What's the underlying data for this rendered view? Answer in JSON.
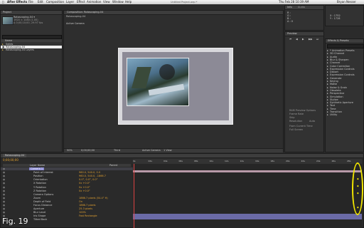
{
  "menubar": {
    "apple": "",
    "app_name": "After Effects",
    "items": [
      "File",
      "Edit",
      "Composition",
      "Layer",
      "Effect",
      "Animation",
      "View",
      "Window",
      "Help"
    ],
    "window_title": "Untitled Project.aep *",
    "clock": "Thu Feb 28  10:39 AM",
    "user": "Bryan Nesser"
  },
  "project_panel": {
    "tab": "Project",
    "item_name": "Rotoscoping-04 ▾",
    "item_info_1": "1920 × 1080 (1.00)",
    "item_info_2": "Δ 0;00;10;00, 29.97 fps",
    "search_placeholder": "",
    "column_header": "Name",
    "items": [
      "Solids",
      "Rotoscoping-04",
      "Rotoscoping-04 Layers"
    ]
  },
  "comp_viewer": {
    "tab": "Composition: Rotoscoping-04",
    "breadcrumb": "Rotoscoping-04",
    "camera_label": "Active Camera",
    "zoom": "50%",
    "timecode": "0;00;00;00",
    "resolution": "Third",
    "view": "Active Camera",
    "views": "1 View"
  },
  "info_panel": {
    "tab": "Info",
    "audio_tab": "Audio",
    "rgba": [
      "R :",
      "G :",
      "B :",
      "A : 0"
    ],
    "xy": [
      "X : 1752",
      "Y : 1728"
    ]
  },
  "preview_panel": {
    "tab": "Preview",
    "labels": [
      "RAM Preview Options",
      "Frame Rate",
      "Skip",
      "Resolution",
      "Auto",
      "From Current Time",
      "Full Screen"
    ]
  },
  "effects_panel": {
    "tab": "Effects & Presets",
    "search_placeholder": "",
    "categories": [
      "* Animation Presets",
      "3D Channel",
      "Audio",
      "Blur & Sharpen",
      "Channel",
      "Color Correction",
      "Expression Controls",
      "Distort",
      "Expression Controls",
      "Generate",
      "Keying",
      "Matte",
      "Noise & Grain",
      "Obsolete",
      "Perspective",
      "Simulation",
      "Stylize",
      "Synthetic Aperture",
      "Text",
      "Time",
      "Transition",
      "Utility"
    ]
  },
  "paragraph_panel": {
    "tab": "Paragraph"
  },
  "timeline": {
    "tab": "Rotoscoping-04",
    "timecode": "0;00;00;00",
    "search_placeholder": "",
    "layer_name_header": "Layer Name",
    "parent_header": "Parent",
    "layers": [
      {
        "name": "Camera 1",
        "value": "",
        "orange": false
      },
      {
        "name": "Point of Interest",
        "value": "960.0, 540.0, 0.0",
        "orange": true
      },
      {
        "name": "Position",
        "value": "960.0, 540.0, -1866.7",
        "orange": true
      },
      {
        "name": "Orientation",
        "value": "0.0°, 0.0°, 0.0°",
        "orange": true
      },
      {
        "name": "X Rotation",
        "value": "0x +0.0°",
        "orange": true
      },
      {
        "name": "Y Rotation",
        "value": "0x +0.0°",
        "orange": true
      },
      {
        "name": "Z Rotation",
        "value": "0x +0.0°",
        "orange": true
      },
      {
        "name": "Camera Options",
        "value": "",
        "orange": false
      },
      {
        "name": "Zoom",
        "value": "1866.7 pixels (54.4° H)",
        "orange": true
      },
      {
        "name": "Depth of Field",
        "value": "On",
        "orange": true
      },
      {
        "name": "Focus Distance",
        "value": "1866.7 pixels",
        "orange": true
      },
      {
        "name": "Aperture",
        "value": "25.3 pixels",
        "orange": true
      },
      {
        "name": "Blur Level",
        "value": "100%",
        "orange": true
      },
      {
        "name": "Iris Shape",
        "value": "Fast Rectangle",
        "orange": true
      },
      {
        "name": "Tilted Back",
        "value": "",
        "orange": false
      }
    ],
    "ruler": [
      "0s",
      "02s",
      "04s",
      "06s",
      "08s",
      "10s",
      "12s",
      "14s",
      "16s",
      "18s",
      "20s",
      "22s",
      "24s",
      "26s",
      "28s"
    ],
    "toggle_label": "Toggle Switches / Modes"
  },
  "fig_label": "Fig. 19",
  "colors": {
    "accent_orange": "#e0a030",
    "annotation_yellow": "#f2e600",
    "layer_bar_pink": "#b89aa8",
    "layer_bar_purple": "#6a6aa6"
  }
}
